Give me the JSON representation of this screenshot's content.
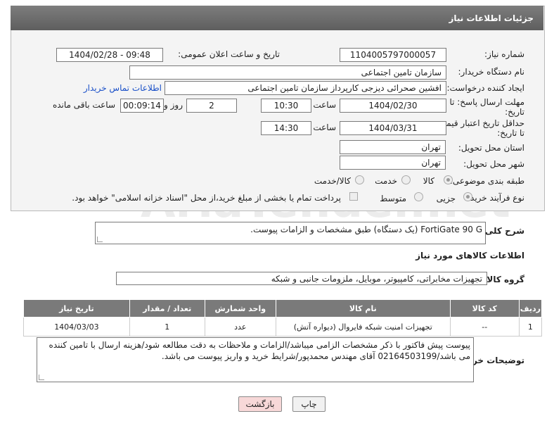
{
  "header": {
    "title": "جزئیات اطلاعات نیاز"
  },
  "fields": {
    "need_number_label": "شماره نیاز:",
    "need_number": "1104005797000057",
    "announce_label": "تاریخ و ساعت اعلان عمومی:",
    "announce_value": "1404/02/28 - 09:48",
    "buyer_org_label": "نام دستگاه خریدار:",
    "buyer_org": "سازمان تامین اجتماعی",
    "creator_label": "ایجاد کننده درخواست:",
    "creator": "افشین صحرائی دیزجی کارپرداز سازمان تامین اجتماعی",
    "contact_link": "اطلاعات تماس خریدار",
    "reply_deadline_label": "مهلت ارسال پاسخ: تا",
    "reply_deadline_label2": "تاریخ:",
    "reply_date": "1404/02/30",
    "time_label": "ساعت",
    "reply_time": "10:30",
    "days_value": "2",
    "days_label": "روز و",
    "remaining_time": "00:09:14",
    "remaining_label": "ساعت باقی مانده",
    "price_validity_label": "حداقل تاریخ اعتبار قیمت:",
    "price_validity_label2": "تا تاریخ:",
    "price_date": "1404/03/31",
    "price_time": "14:30",
    "province_label": "استان محل تحویل:",
    "province": "تهران",
    "city_label": "شهر محل تحویل:",
    "city": "تهران",
    "category_label": "طبقه بندی موضوعی:",
    "category_options": [
      "کالا",
      "خدمت",
      "کالا/خدمت"
    ],
    "process_label": "نوع فرآیند خرید :",
    "process_options": [
      "جزیی",
      "متوسط"
    ],
    "payment_note": "پرداخت تمام یا بخشی از مبلغ خرید،از محل \"اسناد خزانه اسلامی\" خواهد بود."
  },
  "description": {
    "label": "شرح کلی نیاز:",
    "text": "FortiGate 90 G (یک دستگاه) طبق مشخصات و الزامات پیوست."
  },
  "goods": {
    "section_title": "اطلاعات کالاهای مورد نیاز",
    "group_label": "گروه کالا:",
    "group_value": "تجهیزات مخابراتی، کامپیوتر، موبایل، ملزومات جانبی و شبکه"
  },
  "table": {
    "headers": [
      "ردیف",
      "کد کالا",
      "نام کالا",
      "واحد شمارش",
      "تعداد / مقدار",
      "تاریخ نیاز"
    ],
    "rows": [
      [
        "1",
        "--",
        "تجهیزات امنیت شبکه فایروال (دیواره آتش)",
        "عدد",
        "1",
        "1404/03/03"
      ]
    ]
  },
  "buyer_notes": {
    "label": "توضیحات خریدار:",
    "text": "پیوست پیش فاکتور با ذکر مشخصات الزامی میباشد/الزامات و ملاحظات به دقت مطالعه شود/هزینه ارسال با تامین کننده می باشد/02164503199 آقای مهندس محمدپور/شرایط خرید و واریز پیوست می باشد."
  },
  "buttons": {
    "print": "چاپ",
    "back": "بازگشت"
  },
  "watermark": "AriaTender.net",
  "colors": {
    "header_bg": "#6b6b6b",
    "back_button_bg": "#f7d8d8",
    "link": "#1a50c8"
  }
}
